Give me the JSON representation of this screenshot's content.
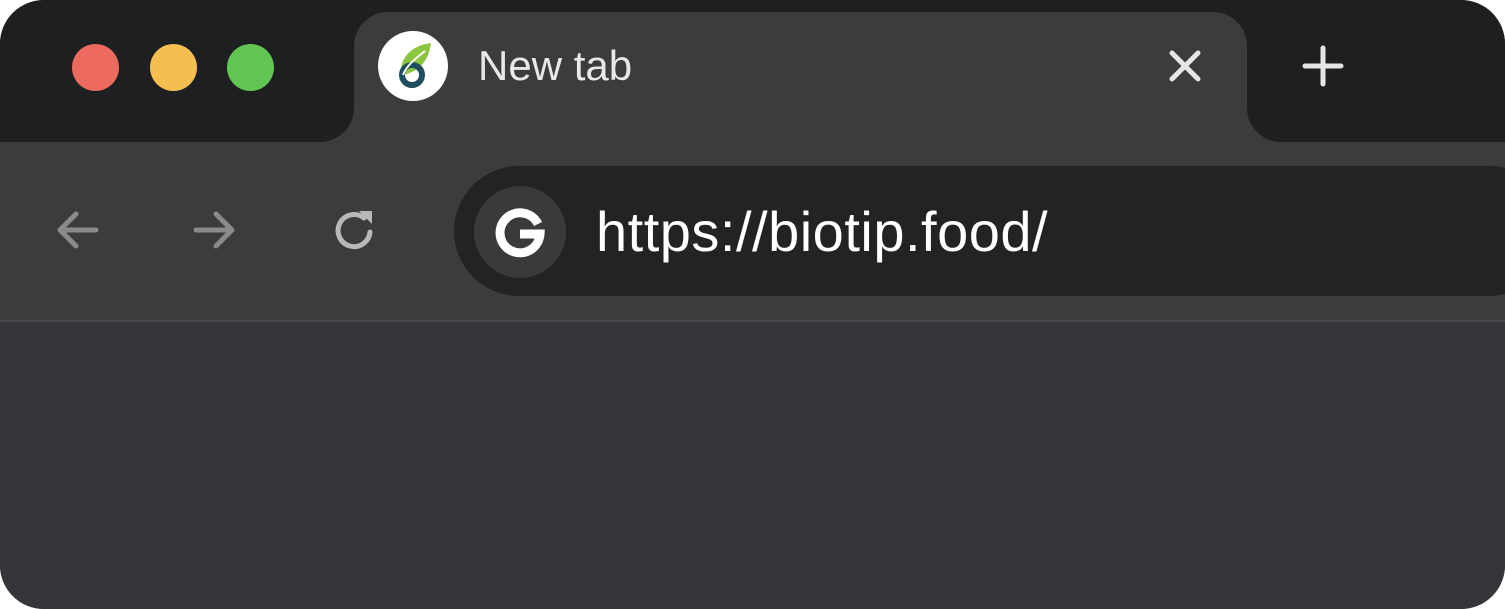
{
  "window": {
    "traffic_lights": {
      "close_color": "#ed6a5e",
      "minimize_color": "#f4bf4f",
      "maximize_color": "#61c554"
    }
  },
  "tab": {
    "title": "New tab",
    "favicon": "biotip-leaf-logo",
    "close_icon": "close-icon"
  },
  "new_tab_icon": "plus-icon",
  "toolbar": {
    "back_icon": "arrow-left-icon",
    "forward_icon": "arrow-right-icon",
    "reload_icon": "reload-icon"
  },
  "omnibox": {
    "search_engine_icon": "google-g-icon",
    "url": "https://biotip.food/"
  },
  "colors": {
    "frame": "#1e1f20",
    "tab_active": "#3c3c3d",
    "omnibox": "#222324",
    "content": "#35363a",
    "text": "#ffffff"
  }
}
